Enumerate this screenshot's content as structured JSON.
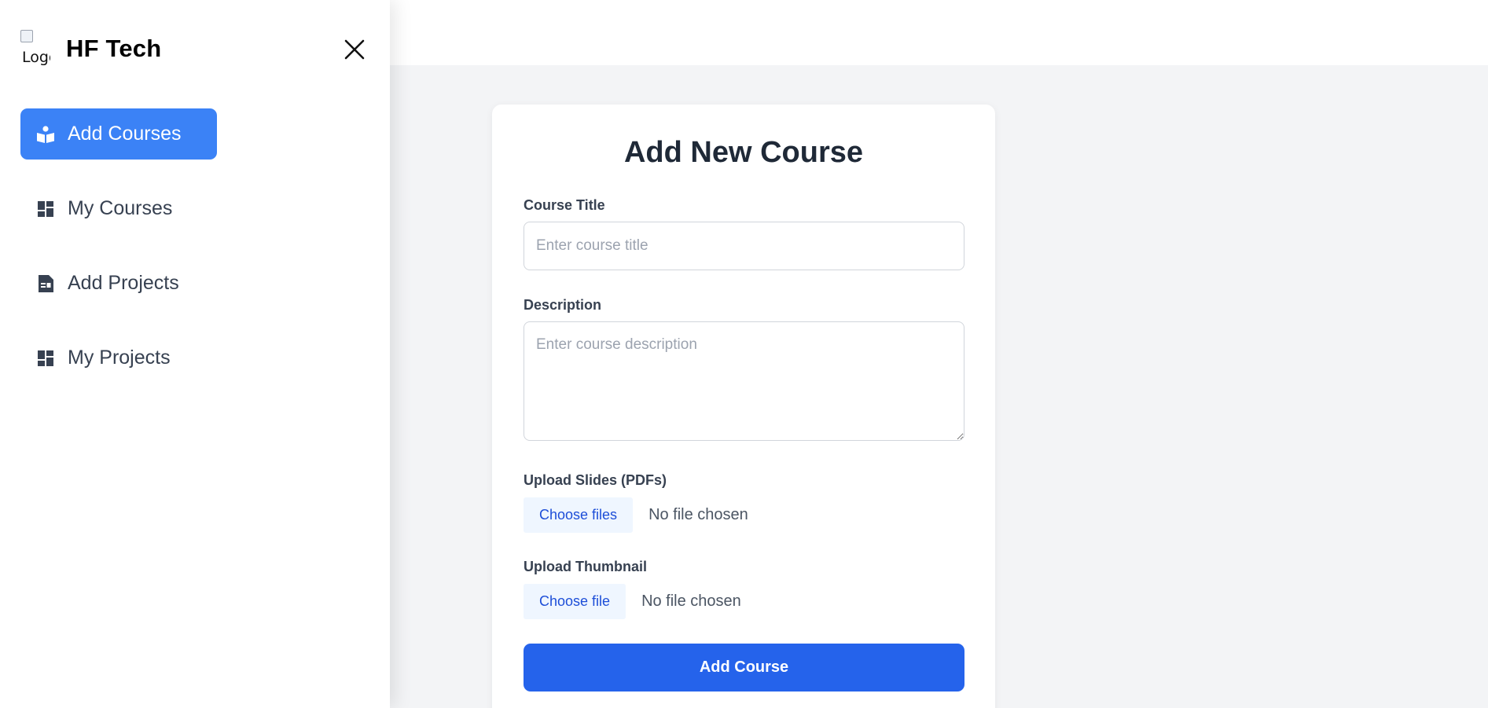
{
  "sidebar": {
    "logo_alt": "Logo",
    "brand_name": "HF Tech",
    "close_icon": "close-icon",
    "items": [
      {
        "label": "Add Courses",
        "icon": "book-reader-icon",
        "active": true
      },
      {
        "label": "My Courses",
        "icon": "dashboard-icon",
        "active": false
      },
      {
        "label": "Add Projects",
        "icon": "document-icon",
        "active": false
      },
      {
        "label": "My Projects",
        "icon": "dashboard-icon",
        "active": false
      }
    ]
  },
  "form": {
    "title": "Add New Course",
    "course_title": {
      "label": "Course Title",
      "placeholder": "Enter course title",
      "value": ""
    },
    "description": {
      "label": "Description",
      "placeholder": "Enter course description",
      "value": ""
    },
    "slides": {
      "label": "Upload Slides (PDFs)",
      "button": "Choose files",
      "status": "No file chosen"
    },
    "thumbnail": {
      "label": "Upload Thumbnail",
      "button": "Choose file",
      "status": "No file chosen"
    },
    "submit_label": "Add Course"
  },
  "colors": {
    "accent": "#3b82f6",
    "primary_button": "#2563eb",
    "file_button_bg": "#eff6ff",
    "file_button_text": "#1d4ed8",
    "page_bg": "#f3f4f6"
  }
}
